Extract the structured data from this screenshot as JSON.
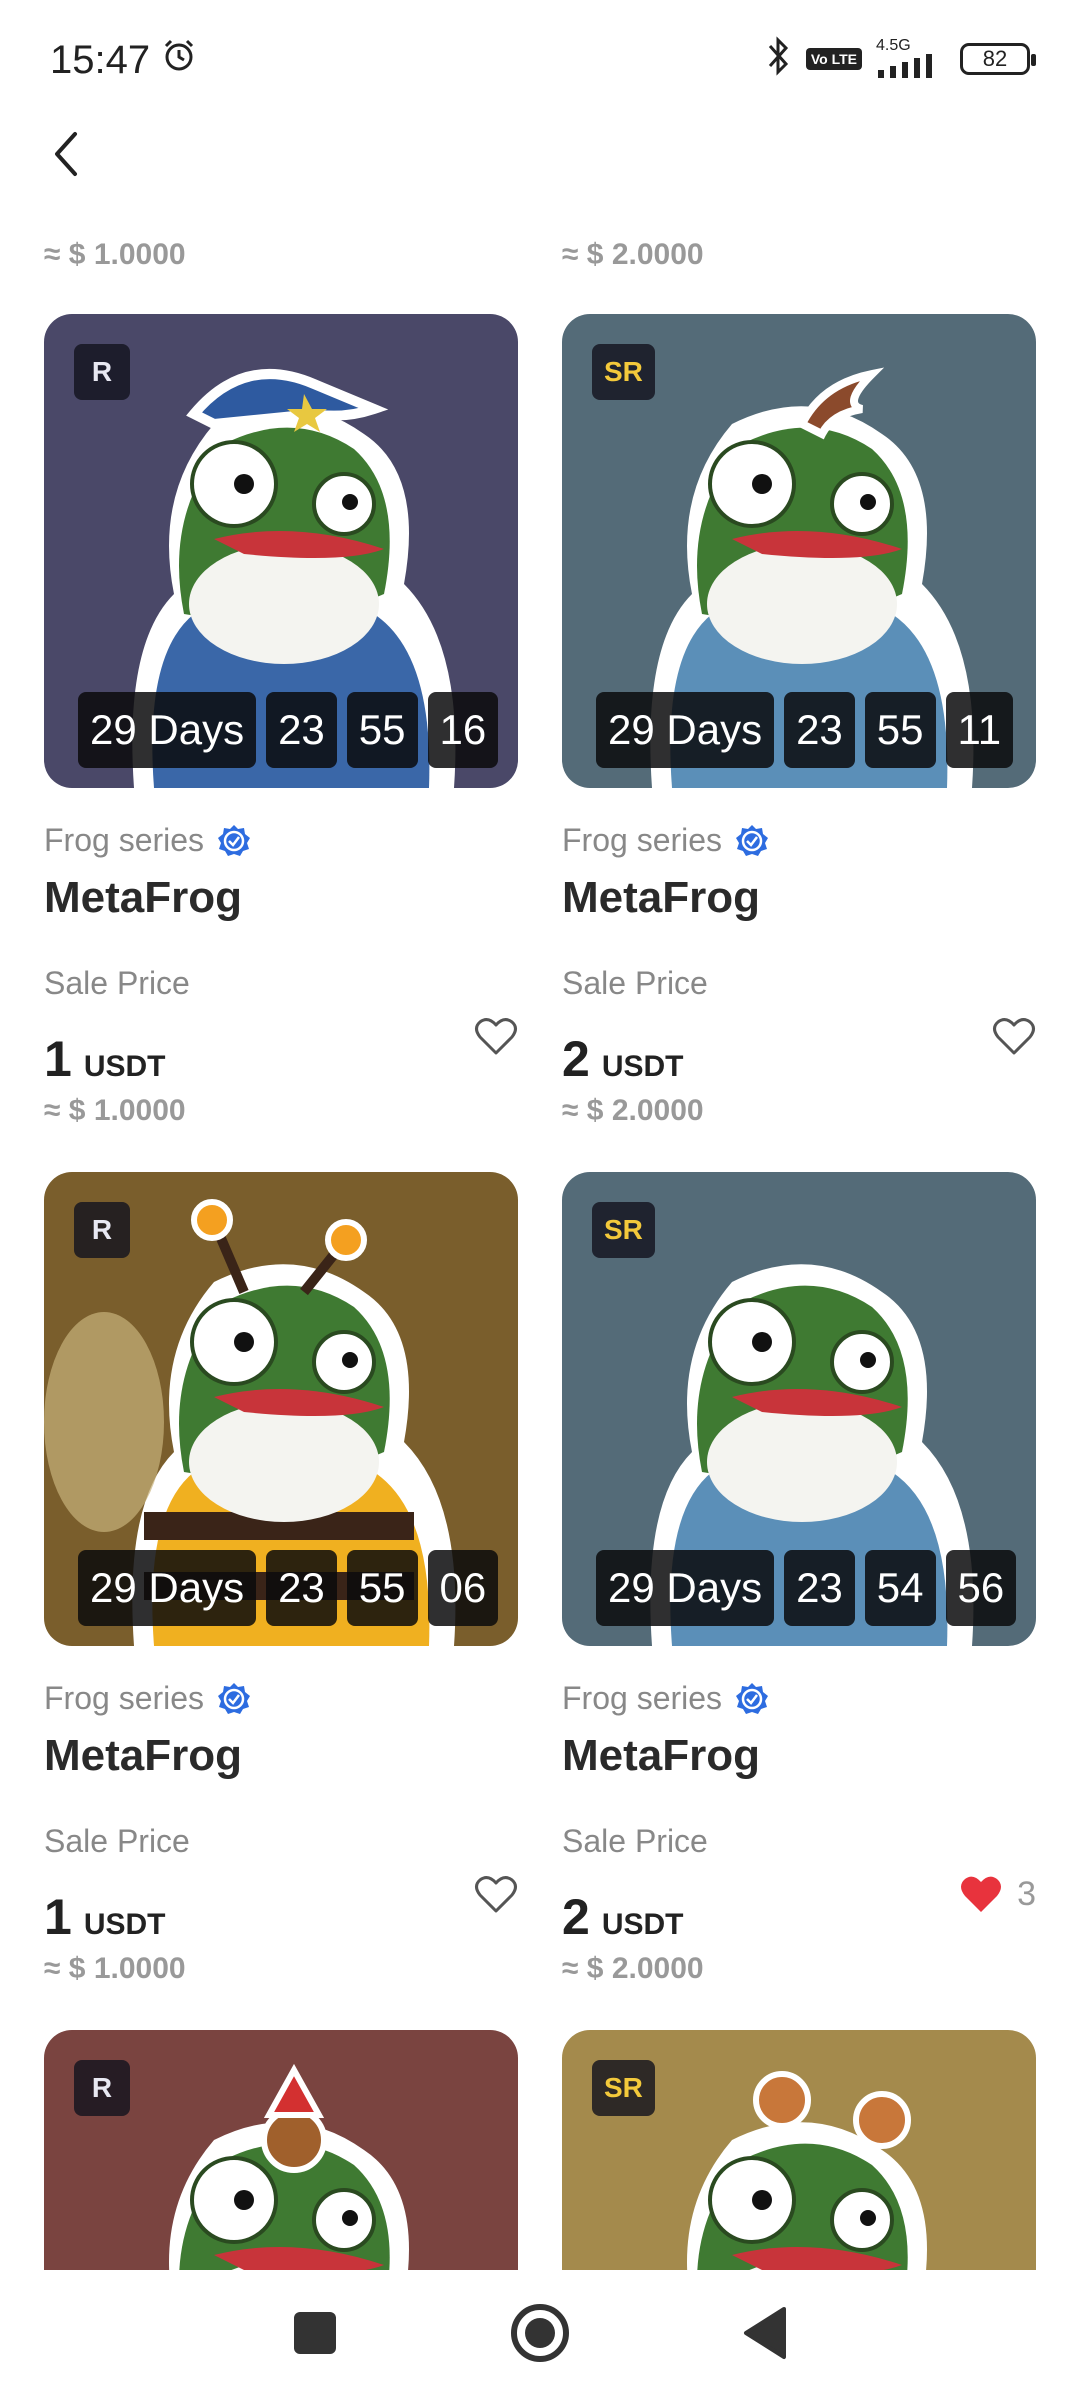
{
  "status": {
    "time": "15:47",
    "network": "4.5G",
    "volte": "Vo LTE",
    "battery": "82"
  },
  "top_partial": {
    "left_approx": "≈ $ 1.0000",
    "right_approx": "≈ $ 2.0000"
  },
  "labels": {
    "sale_price": "Sale Price"
  },
  "cards": [
    {
      "rarity": "R",
      "series": "Frog series",
      "name": "MetaFrog",
      "days": "29 Days",
      "hours": "23",
      "minutes": "55",
      "seconds": "16",
      "price": "1",
      "unit": "USDT",
      "approx": "≈ $ 1.0000",
      "bg": "#4a4868",
      "liked": false,
      "likes": ""
    },
    {
      "rarity": "SR",
      "series": "Frog series",
      "name": "MetaFrog",
      "days": "29 Days",
      "hours": "23",
      "minutes": "55",
      "seconds": "11",
      "price": "2",
      "unit": "USDT",
      "approx": "≈ $ 2.0000",
      "bg": "#546b78",
      "liked": false,
      "likes": ""
    },
    {
      "rarity": "R",
      "series": "Frog series",
      "name": "MetaFrog",
      "days": "29 Days",
      "hours": "23",
      "minutes": "55",
      "seconds": "06",
      "price": "1",
      "unit": "USDT",
      "approx": "≈ $ 1.0000",
      "bg": "#7a5e2c",
      "liked": false,
      "likes": ""
    },
    {
      "rarity": "SR",
      "series": "Frog series",
      "name": "MetaFrog",
      "days": "29 Days",
      "hours": "23",
      "minutes": "54",
      "seconds": "56",
      "price": "2",
      "unit": "USDT",
      "approx": "≈ $ 2.0000",
      "bg": "#546b78",
      "liked": true,
      "likes": "3"
    },
    {
      "rarity": "R",
      "bg": "#7a4440"
    },
    {
      "rarity": "SR",
      "bg": "#a48a4c"
    }
  ],
  "colors": {
    "accent_blue": "#2d6ce0",
    "like_red": "#e8333d",
    "text_gray": "#888888"
  },
  "icons": {
    "back": "chevron-left-icon",
    "verified": "verified-badge-icon",
    "heart": "heart-outline-icon",
    "heart_filled": "heart-filled-icon"
  }
}
